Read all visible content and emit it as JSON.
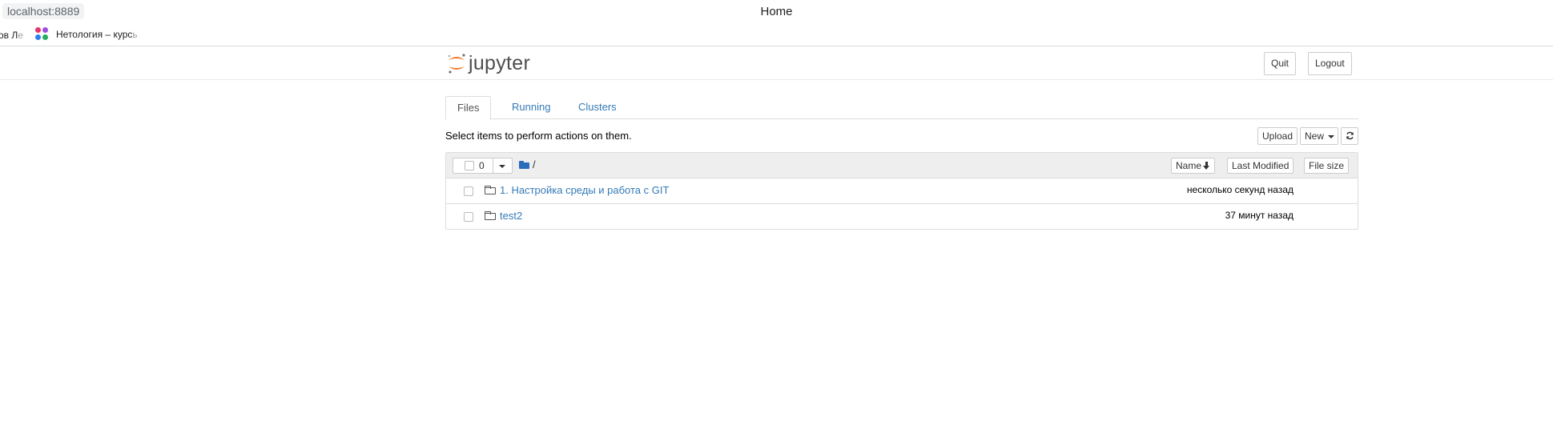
{
  "browser": {
    "url": "localhost:8889",
    "window_title": "Home",
    "bookmarks": [
      {
        "label_visible": "ов Л",
        "label_faded": "е"
      },
      {
        "label_visible": "Нетология – курс",
        "label_faded": "ь"
      }
    ]
  },
  "header": {
    "logo_text": "jupyter",
    "quit_label": "Quit",
    "logout_label": "Logout"
  },
  "tabs": [
    {
      "label": "Files",
      "active": true
    },
    {
      "label": "Running",
      "active": false
    },
    {
      "label": "Clusters",
      "active": false
    }
  ],
  "toolbar": {
    "hint": "Select items to perform actions on them.",
    "upload_label": "Upload",
    "new_label": "New",
    "refresh_icon": "refresh-icon"
  },
  "list_header": {
    "selected_count": "0",
    "path": "/",
    "sort_name_label": "Name",
    "sort_modified_label": "Last Modified",
    "sort_size_label": "File size"
  },
  "items": [
    {
      "name": "1. Настройка среды и работа с GIT",
      "modified": "несколько секунд назад",
      "icon": "folder-icon"
    },
    {
      "name": "test2",
      "modified": "37 минут назад",
      "icon": "folder-icon"
    }
  ],
  "colors": {
    "link": "#337ab7",
    "jupyter_orange": "#f37726",
    "folder_blue": "#2a6ebb"
  }
}
